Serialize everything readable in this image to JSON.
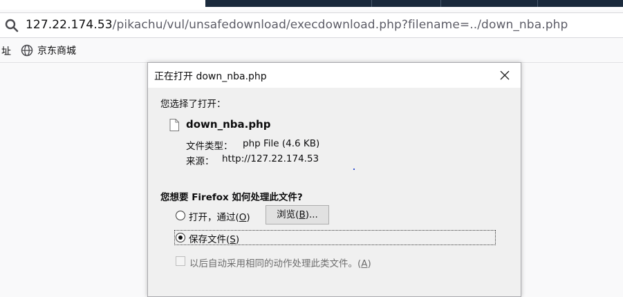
{
  "browser": {
    "url": {
      "host": "127.22.174.53",
      "path": "/pikachu/vul/unsafedownload/execdownload.php?filename=../down_nba.php"
    },
    "bookmarks": {
      "partial_label": "址",
      "items": [
        {
          "icon": "globe-icon",
          "label": "京东商城"
        }
      ]
    }
  },
  "dialog": {
    "title": "正在打开 down_nba.php",
    "prompt": "您选择了打开：",
    "file": {
      "icon": "file-icon",
      "name": "down_nba.php",
      "type_label": "文件类型：",
      "type_value": "php File (4.6 KB)",
      "source_label": "来源：",
      "source_value": "http://127.22.174.53"
    },
    "question": "您想要 Firefox 如何处理此文件?",
    "options": {
      "open_with": {
        "label_prefix": "打开，通过(",
        "accesskey": "O",
        "label_suffix": ")",
        "selected": false
      },
      "browse": {
        "label_prefix": "浏览(",
        "accesskey": "B",
        "label_suffix": ")..."
      },
      "save_file": {
        "label_prefix": "保存文件(",
        "accesskey": "S",
        "label_suffix": ")",
        "selected": true
      }
    },
    "remember": {
      "label_prefix": "以后自动采用相同的动作处理此类文件。(",
      "accesskey": "A",
      "label_suffix": ")",
      "checked": false,
      "disabled": true
    }
  },
  "colors": {
    "tabstrip": "#1c2b3d",
    "dialog_bg": "#f0f0f0",
    "button_bg": "#e1e1e1",
    "disabled_text": "#6d6d6d"
  }
}
